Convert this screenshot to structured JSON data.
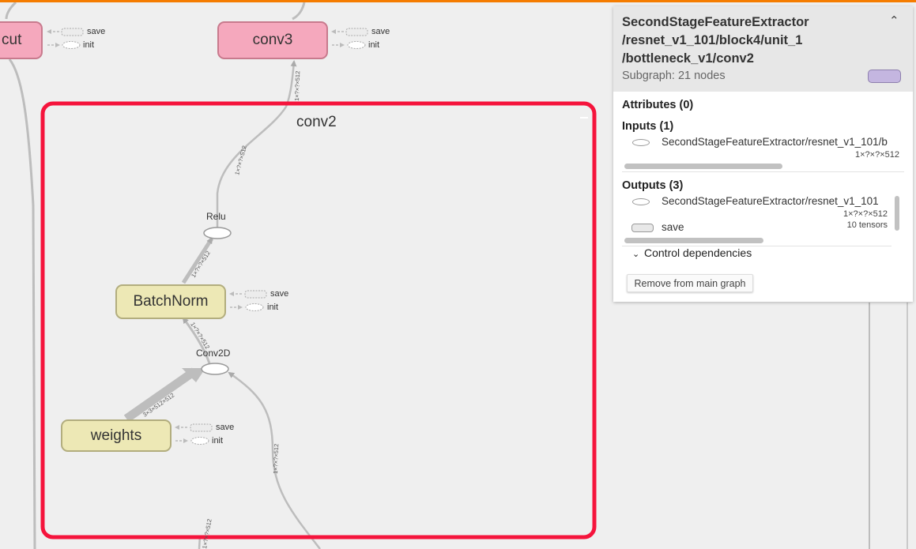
{
  "graph": {
    "nodes": {
      "shortcut_clipped": "cut",
      "conv3": "conv3",
      "batchnorm": "BatchNorm",
      "weights": "weights"
    },
    "ops": {
      "relu": "Relu",
      "conv2d": "Conv2D"
    },
    "side_labels": {
      "save": "save",
      "init": "init"
    },
    "group": {
      "title": "conv2"
    },
    "edges": {
      "to_conv3": "1×?×?×512",
      "relu_out": "1×?×?×512",
      "bn_to_relu": "1×?×?×512",
      "conv2d_to_bn": "1×?×?×512",
      "weights_to_conv2d": "3×3×512×512",
      "input_to_conv2d": "1×?×?×512",
      "bottom": "1×?×?×512"
    }
  },
  "panel": {
    "title_line1": "SecondStageFeatureExtractor",
    "title_line2": "/resnet_v1_101/block4/unit_1",
    "title_line3": "/bottleneck_v1/conv2",
    "subtitle": "Subgraph: 21 nodes",
    "swatch_color": "#c4b6e0",
    "collapse_icon": "chevron-up-icon",
    "attributes_label": "Attributes (0)",
    "inputs_label": "Inputs (1)",
    "inputs": [
      {
        "name": "SecondStageFeatureExtractor/resnet_v1_101/b",
        "shape": "1×?×?×512"
      }
    ],
    "outputs_label": "Outputs (3)",
    "outputs": [
      {
        "name": "SecondStageFeatureExtractor/resnet_v1_101",
        "shape": "1×?×?×512"
      },
      {
        "name": "save",
        "shape": "10 tensors"
      }
    ],
    "control_dependencies": "Control dependencies",
    "remove_button": "Remove from main graph"
  },
  "colors": {
    "accent_bar": "#f57c00",
    "group_border": "#f5143c",
    "meta_node": "#f5a8bd",
    "op_node": "#ede8b5"
  }
}
